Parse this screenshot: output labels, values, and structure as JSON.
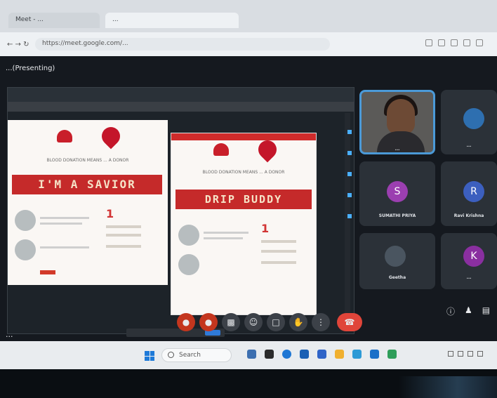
{
  "browser": {
    "tabs": [
      {
        "label": "Meet - ..."
      },
      {
        "label": "..."
      }
    ],
    "address": "https://meet.google.com/..."
  },
  "meet": {
    "title": "...(Presenting)"
  },
  "presentation": {
    "slide1": {
      "tagline": "BLOOD DONATION MEANS ... A DONOR",
      "banner": "I'M A SAVIOR"
    },
    "slide2": {
      "tagline": "BLOOD DONATION MEANS ... A DONOR",
      "banner": "DRIP BUDDY"
    }
  },
  "participants": [
    {
      "name": "...",
      "initial": "",
      "color": "#3a4046"
    },
    {
      "name": "...",
      "initial": "",
      "color": "#2e6fb0"
    },
    {
      "name": "SUMATHI PRIYA",
      "initial": "S",
      "color": "#9b3fb0"
    },
    {
      "name": "Ravi Krishna",
      "initial": "R",
      "color": "#3c5fbf"
    },
    {
      "name": "Geetha",
      "initial": "",
      "color": "#4a5560"
    },
    {
      "name": "...",
      "initial": "K",
      "color": "#8a2fa0"
    }
  ],
  "controls": {
    "meeting_code": "...",
    "end_call_icon": "phone-hangup-icon"
  },
  "taskbar": {
    "search_label": "Search"
  }
}
